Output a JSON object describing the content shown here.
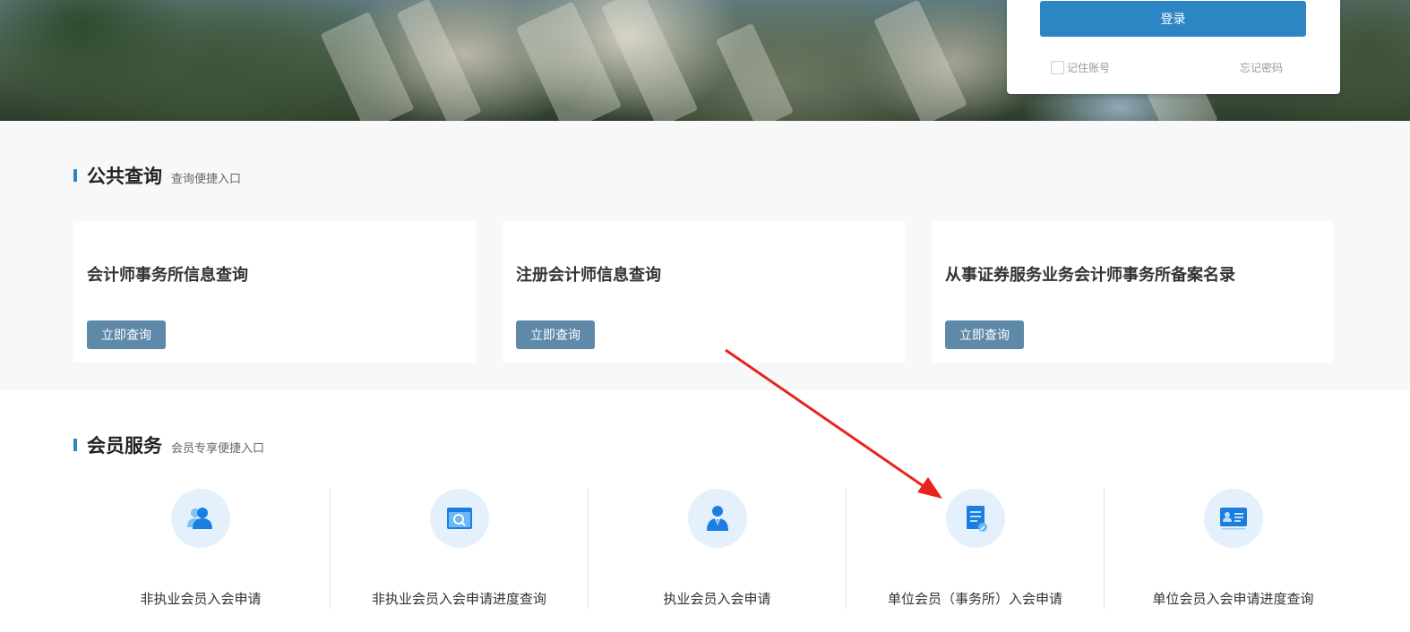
{
  "login": {
    "login_label": "登录",
    "remember_label": "记住账号",
    "forgot_label": "忘记密码"
  },
  "public_query": {
    "title": "公共查询",
    "subtitle": "查询便捷入口",
    "cards": [
      {
        "title": "会计师事务所信息查询",
        "button": "立即查询"
      },
      {
        "title": "注册会计师信息查询",
        "button": "立即查询"
      },
      {
        "title": "从事证券服务业务会计师事务所备案名录",
        "button": "立即查询"
      }
    ]
  },
  "member_services": {
    "title": "会员服务",
    "subtitle": "会员专享便捷入口",
    "items": [
      {
        "label": "非执业会员入会申请",
        "icon": "users-icon"
      },
      {
        "label": "非执业会员入会申请进度查询",
        "icon": "search-window-icon"
      },
      {
        "label": "执业会员入会申请",
        "icon": "suit-person-icon"
      },
      {
        "label": "单位会员（事务所）入会申请",
        "icon": "document-edit-icon"
      },
      {
        "label": "单位会员入会申请进度查询",
        "icon": "id-card-icon"
      }
    ]
  },
  "colors": {
    "accent": "#2d86c4",
    "query_button": "#5e89a8",
    "icon_bg": "#e4f1fd",
    "annotation_arrow": "#e8231f"
  }
}
